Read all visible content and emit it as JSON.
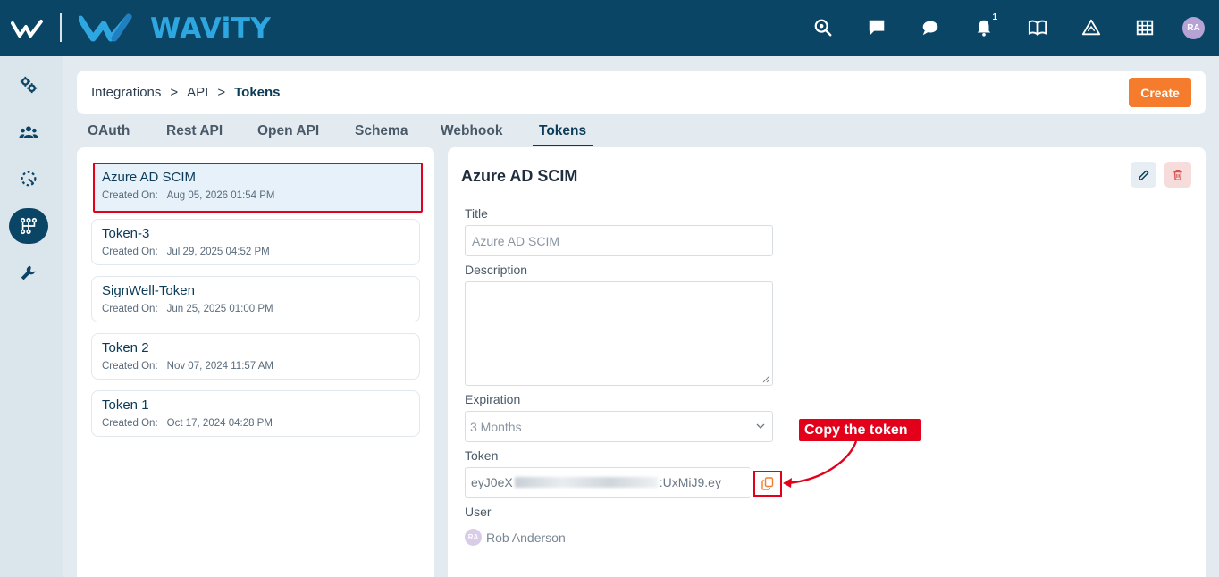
{
  "header": {
    "brand": "WAViTY",
    "notification_count": "1",
    "avatar_initials": "RA",
    "icons": [
      "search-settings-icon",
      "chat-bubble-icon",
      "comment-icon",
      "bell-icon",
      "book-icon",
      "warning-triangle-icon",
      "grid-icon"
    ]
  },
  "sidebar": {
    "items": [
      "settings-gear-icon",
      "users-group-icon",
      "dashed-circle-icon",
      "integrations-icon",
      "wrench-icon"
    ],
    "active": "integrations-icon"
  },
  "breadcrumb": {
    "items": [
      "Integrations",
      "API",
      "Tokens"
    ],
    "separator": ">"
  },
  "create_label": "Create",
  "tabs": [
    {
      "label": "OAuth"
    },
    {
      "label": "Rest API"
    },
    {
      "label": "Open API"
    },
    {
      "label": "Schema"
    },
    {
      "label": "Webhook"
    },
    {
      "label": "Tokens",
      "active": true
    }
  ],
  "tokens": [
    {
      "name": "Azure AD SCIM",
      "created_label": "Created On:",
      "created": "Aug 05, 2026 01:54 PM",
      "selected": true
    },
    {
      "name": "Token-3",
      "created_label": "Created On:",
      "created": "Jul 29, 2025 04:52 PM"
    },
    {
      "name": "SignWell-Token",
      "created_label": "Created On:",
      "created": "Jun 25, 2025 01:00 PM"
    },
    {
      "name": "Token 2",
      "created_label": "Created On:",
      "created": "Nov 07, 2024 11:57 AM"
    },
    {
      "name": "Token 1",
      "created_label": "Created On:",
      "created": "Oct 17, 2024 04:28 PM"
    }
  ],
  "detail": {
    "title": "Azure AD SCIM",
    "title_label": "Title",
    "title_value": "Azure AD SCIM",
    "description_label": "Description",
    "description_value": "",
    "expiration_label": "Expiration",
    "expiration_value": "3 Months",
    "token_label": "Token",
    "token_prefix": "eyJ0eX",
    "token_suffix": ":UxMiJ9.ey",
    "user_label": "User",
    "user_initials": "RA",
    "user_name": "Rob Anderson"
  },
  "annotation": {
    "callout_text": "Copy the token",
    "color": "#e3001b"
  },
  "colors": {
    "header_bg": "#0b4566",
    "accent": "#f47c2c",
    "brand_blue": "#2ea7e0",
    "highlight_red": "#e3001b"
  }
}
